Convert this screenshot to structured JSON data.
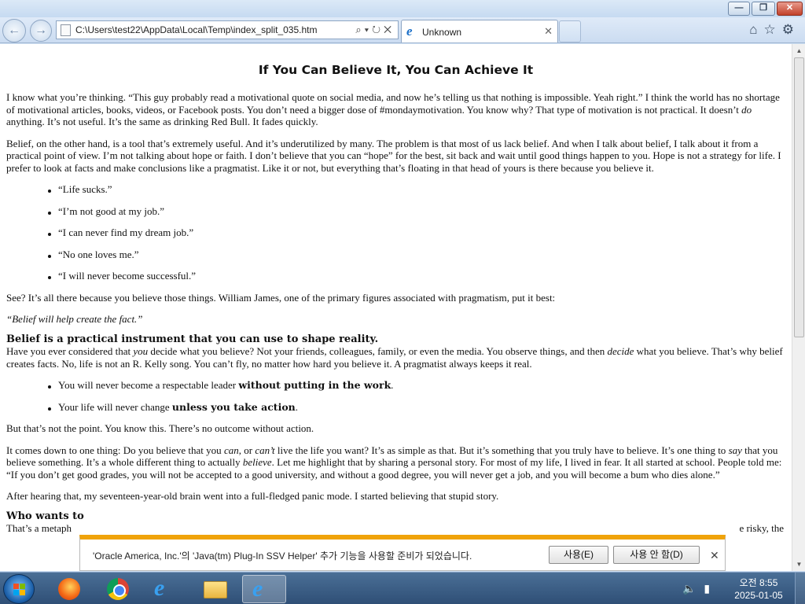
{
  "window": {
    "minimize_symbol": "—",
    "maximize_symbol": "❐",
    "close_symbol": "✕"
  },
  "toolbar": {
    "back_symbol": "←",
    "forward_symbol": "→",
    "address": "C:\\Users\\test22\\AppData\\Local\\Temp\\index_split_035.htm",
    "address_tools": "⌕▾↻✕",
    "tab_label": "Unknown",
    "tab_close": "✕",
    "ie_glyph": "e",
    "right_icons": "⌂☆⚙"
  },
  "article": {
    "title": "If You Can Believe It, You Can Achieve It",
    "p1_a": "I know what you’re thinking. “This guy probably read a motivational quote on social media, and now he’s telling us that nothing is impossible. Yeah right.” I think the world has no shortage of motivational articles, books, videos, or Facebook posts. You don’t need a bigger dose of #mondaymotivation. You know why? That type of motivation is not practical. It doesn’t ",
    "p1_em": "do",
    "p1_b": " anything. It’s not useful. It’s the same as drinking Red Bull. It fades quickly.",
    "p2": "Belief, on the other hand, is a tool that’s extremely useful. And it’s underutilized by many. The problem is that most of us lack belief. And when I talk about belief, I talk about it from a practical point of view. I’m not talking about hope or faith. I don’t believe that you can “hope” for the best, sit back and wait until good things happen to you. Hope is not a strategy for life. I prefer to look at facts and make conclusions like a pragmatist. Like it or not, but everything that’s floating in that head of yours is there because you believe it.",
    "list1": [
      "“Life sucks.”",
      "“I’m not good at my job.”",
      "“I can never find my dream job.”",
      "“No one loves me.”",
      "“I will never become successful.”"
    ],
    "p3": "See? It’s all there because you believe those things. William James, one of the primary figures associated with pragmatism, put it best:",
    "quote": "“Belief will help create the fact.”",
    "h_belief": "Belief is a practical instrument that you can use to shape reality.",
    "p4_a": "Have you ever considered that ",
    "p4_em1": "you",
    "p4_b": " decide what you believe? Not your friends, colleagues, family, or even the media. You observe things, and then ",
    "p4_em2": "decide",
    "p4_c": " what you believe. That’s why belief creates facts. No, life is not an R. Kelly song. You can’t fly, no matter how hard you believe it. A pragmatist always keeps it real.",
    "list2": [
      {
        "text": "You will never become a respectable leader ",
        "strong": "without putting in the work",
        "end": "."
      },
      {
        "text": "Your life will never change ",
        "strong": "unless you take action",
        "end": "."
      }
    ],
    "p5": "But that’s not the point. You know this. There’s no outcome without action.",
    "p6_a": "It comes down to one thing: Do you believe that you ",
    "p6_em1": "can",
    "p6_b": ", or ",
    "p6_em2": "can’t",
    "p6_c": " live the life you want? It’s as simple as that. But it’s something that you truly have to believe. It’s one thing to ",
    "p6_em3": "say",
    "p6_d": " that you believe something. It’s a whole different thing to actually ",
    "p6_em4": "believe",
    "p6_e": ". Let me highlight that by sharing a personal story. For most of my life, I lived in fear. It all started at school. People told me: “If you don’t get good grades, you will not be accepted to a good university, and without a good degree, you will never get a job, and you will become a bum who dies alone.”",
    "p7": "After hearing that, my seventeen-year-old brain went into a full-fledged panic mode. I started believing that stupid story.",
    "h_who": "Who wants to",
    "p8_left": "That’s a metaph",
    "p8_right": "e risky, the"
  },
  "notification": {
    "message": "'Oracle America, Inc.'의 'Java(tm) Plug-In SSV Helper' 추가 기능을 사용할 준비가 되었습니다.",
    "use_label": "사용(E)",
    "nouse_label": "사용 안 함(D)",
    "close_symbol": "✕"
  },
  "scrollbar": {
    "up_symbol": "▲",
    "down_symbol": "▼"
  },
  "taskbar": {
    "tray_icons": "🔈▮",
    "time": "오전 8:55",
    "date": "2025-01-05"
  },
  "colors": {
    "notification_accent": "#f0a30a",
    "taskbar": "#2f4f76",
    "ie_blue": "#39a0f0"
  }
}
